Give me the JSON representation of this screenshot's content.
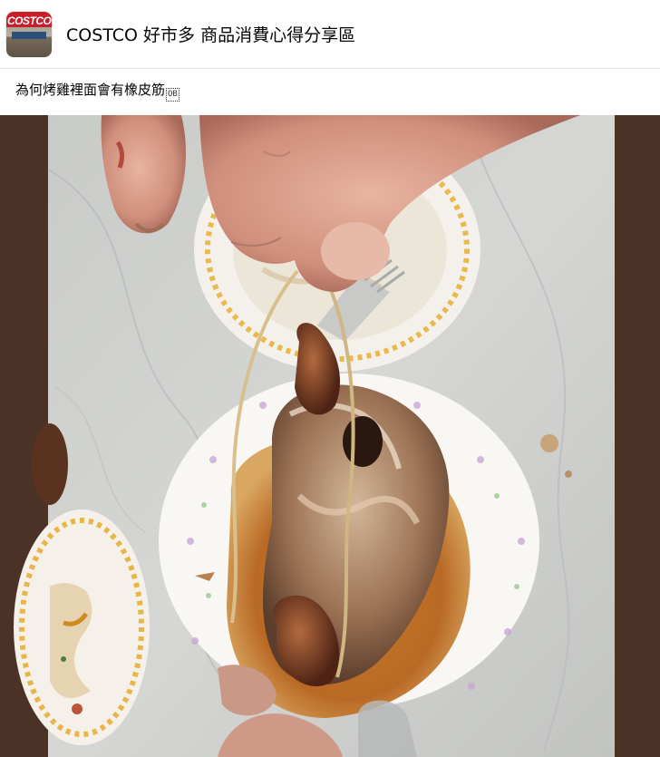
{
  "header": {
    "group_name": "COSTCO 好市多 商品消費心得分享區",
    "avatar_logo_text": "COSTCO"
  },
  "post": {
    "text": "為何烤雞裡面會有橡皮筋",
    "emoji_placeholder": "OB"
  },
  "colors": {
    "photo_side_background": "#4a3326",
    "header_divider": "#e4e6eb"
  }
}
